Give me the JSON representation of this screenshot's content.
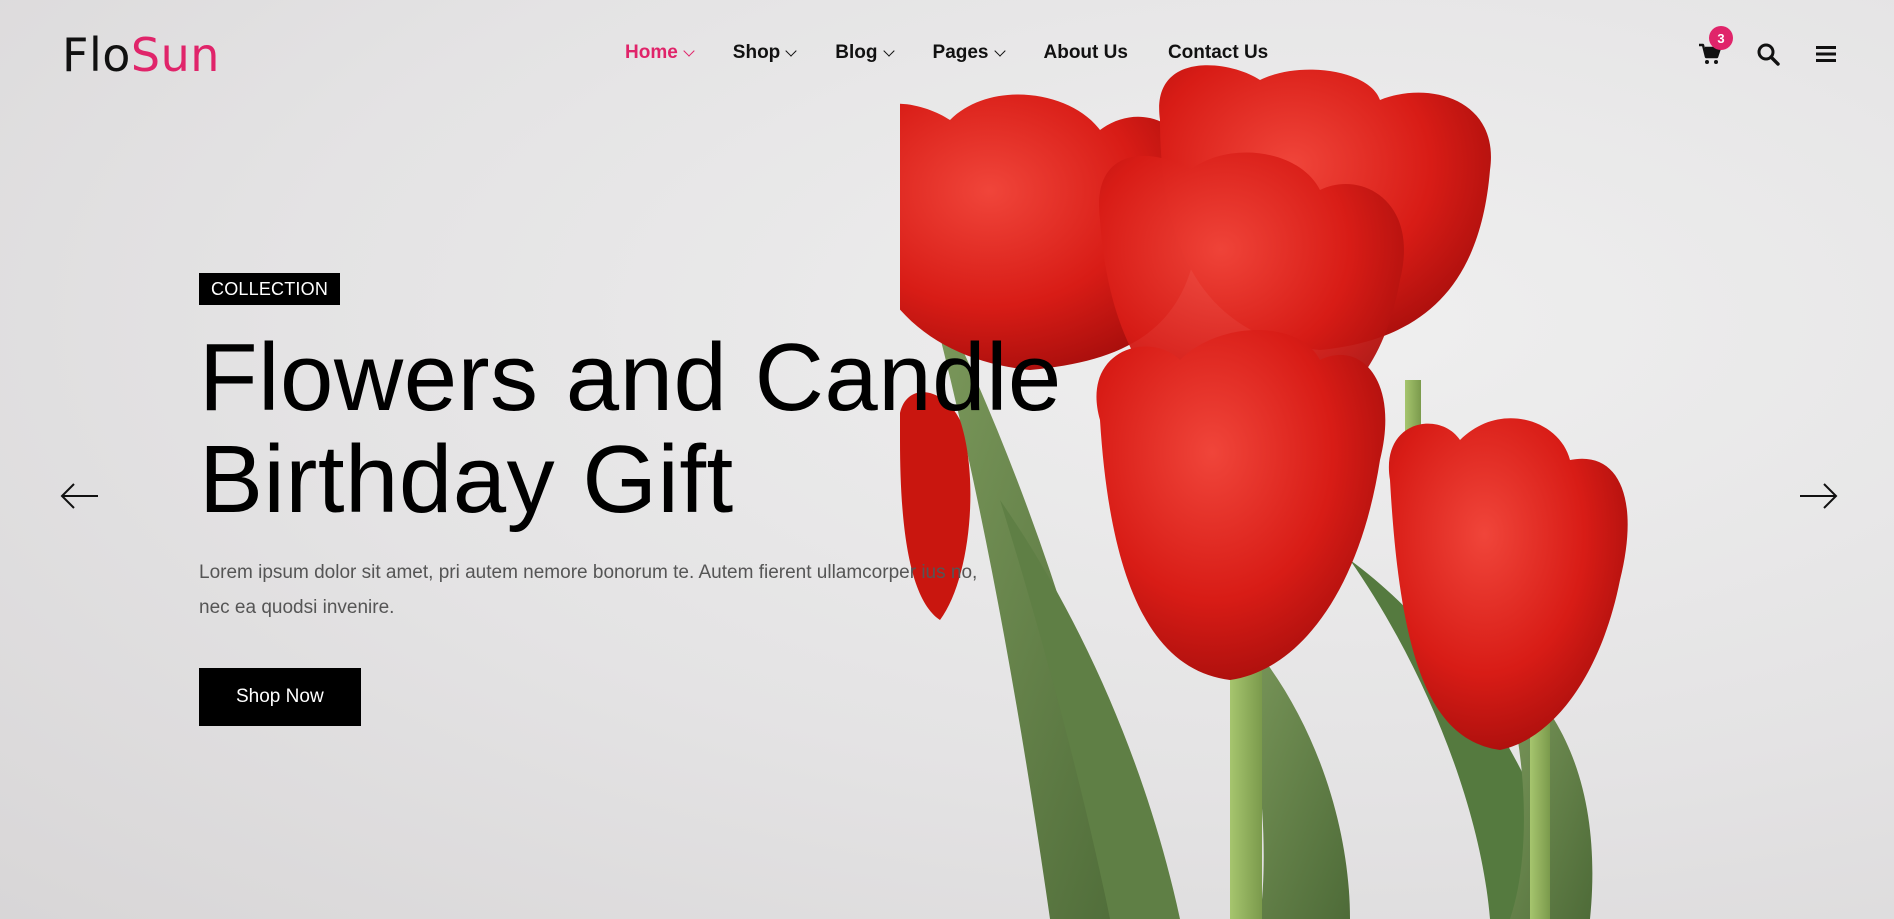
{
  "brand": {
    "logo_part1": "Flo",
    "logo_part2": "Sun",
    "accent_color": "#e0246a"
  },
  "nav": {
    "items": [
      {
        "label": "Home",
        "has_dropdown": true,
        "active": true
      },
      {
        "label": "Shop",
        "has_dropdown": true,
        "active": false
      },
      {
        "label": "Blog",
        "has_dropdown": true,
        "active": false
      },
      {
        "label": "Pages",
        "has_dropdown": true,
        "active": false
      },
      {
        "label": "About Us",
        "has_dropdown": false,
        "active": false
      },
      {
        "label": "Contact Us",
        "has_dropdown": false,
        "active": false
      }
    ]
  },
  "header_actions": {
    "cart_icon": "cart-icon",
    "cart_count": "3",
    "search_icon": "search-icon",
    "menu_icon": "hamburger-menu-icon"
  },
  "hero": {
    "tag": "COLLECTION",
    "headline_line1": "Flowers and Candle",
    "headline_line2": "Birthday Gift",
    "description": "Lorem ipsum dolor sit amet, pri autem nemore bonorum te. Autem fierent ullamcorper ius no, nec ea quodsi invenire.",
    "cta_label": "Shop Now",
    "prev_icon": "arrow-left-icon",
    "next_icon": "arrow-right-icon"
  }
}
